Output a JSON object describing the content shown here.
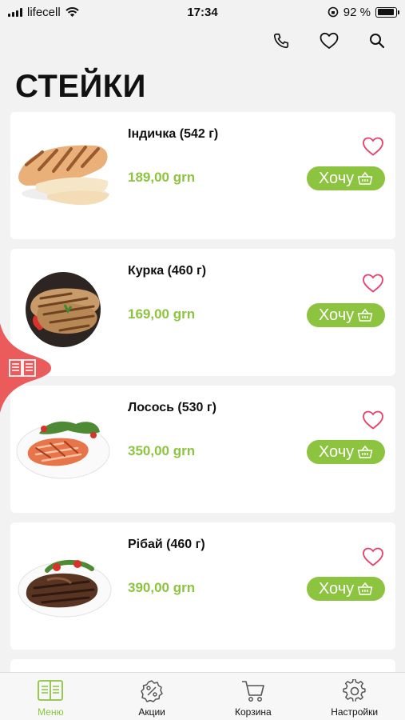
{
  "status": {
    "carrier": "lifecell",
    "time": "17:34",
    "battery": "92 %",
    "battery_level": 0.92
  },
  "header": {
    "icons": [
      "phone-icon",
      "heart-icon",
      "search-icon"
    ]
  },
  "page_title": "СТЕЙКИ",
  "products": [
    {
      "name": "Індичка (542 г)",
      "price": "189,00 grn",
      "button": "Хочу",
      "image": "turkey-steak"
    },
    {
      "name": "Курка (460 г)",
      "price": "169,00 grn",
      "button": "Хочу",
      "image": "chicken-steak"
    },
    {
      "name": "Лосось (530 г)",
      "price": "350,00 grn",
      "button": "Хочу",
      "image": "salmon-steak"
    },
    {
      "name": "Рібай (460 г)",
      "price": "390,00 grn",
      "button": "Хочу",
      "image": "ribeye-steak"
    }
  ],
  "colors": {
    "accent": "#8cc43f",
    "heart": "#e8406a",
    "side_tab": "#ec5b5b"
  },
  "tabbar": [
    {
      "label": "Меню",
      "icon": "menu-book-icon",
      "active": true
    },
    {
      "label": "Акции",
      "icon": "discount-icon",
      "active": false
    },
    {
      "label": "Корзина",
      "icon": "cart-icon",
      "active": false
    },
    {
      "label": "Настройки",
      "icon": "gear-icon",
      "active": false
    }
  ]
}
